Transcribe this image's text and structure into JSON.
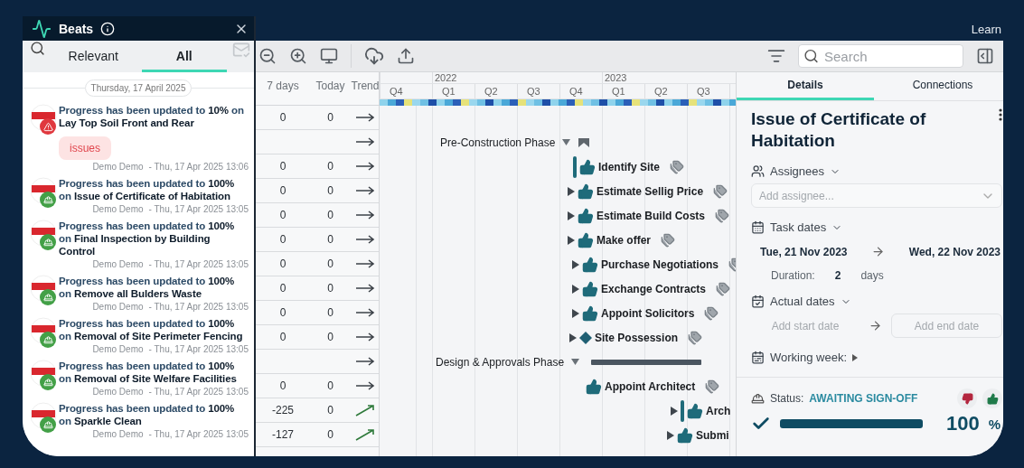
{
  "top_bar": {
    "link": "Learn"
  },
  "beats": {
    "title": "Beats",
    "tabs": [
      {
        "label": "Relevant",
        "selected": false
      },
      {
        "label": "All",
        "selected": true
      }
    ],
    "date": "Thursday, 17 April 2025",
    "items": [
      {
        "kind": "warning",
        "message": "Progress has been updated to **10%** on **Lay Top Soil Front and Rear**",
        "tag": "issues",
        "author": "Demo Demo",
        "time": "- Thu, 17 Apr 2025 13:06"
      },
      {
        "kind": "worker",
        "message": "Progress has been updated to **100%** on **Issue of Certificate of Habitation**",
        "author": "Demo Demo",
        "time": "- Thu, 17 Apr 2025 13:05"
      },
      {
        "kind": "worker",
        "message": "Progress has been updated to **100%** on **Final Inspection by Building Control**",
        "author": "Demo Demo",
        "time": "- Thu, 17 Apr 2025 13:05"
      },
      {
        "kind": "worker",
        "message": "Progress has been updated to **100%** on **Remove all Bulders Waste**",
        "author": "Demo Demo",
        "time": "- Thu, 17 Apr 2025 13:05"
      },
      {
        "kind": "worker",
        "message": "Progress has been updated to **100%** on **Removal of Site Perimeter Fencing**",
        "author": "Demo Demo",
        "time": "- Thu, 17 Apr 2025 13:05"
      },
      {
        "kind": "worker",
        "message": "Progress has been updated to **100%** on **Removal of Site Welfare Facilities**",
        "author": "Demo Demo",
        "time": "- Thu, 17 Apr 2025 13:05"
      },
      {
        "kind": "worker",
        "message": "Progress has been updated to **100%** on **Sparkle Clean**",
        "author": "Demo Demo",
        "time": "- Thu, 17 Apr 2025 13:05"
      }
    ]
  },
  "toolbar": {
    "search": {
      "placeholder": "Search"
    }
  },
  "table": {
    "columns": [
      "7 days",
      "Today",
      "Trend"
    ],
    "rows": [
      {
        "week": "0",
        "today": "0",
        "kind": "flat"
      },
      {
        "kind": "flat"
      },
      {
        "week": "0",
        "today": "0",
        "kind": "flat"
      },
      {
        "week": "0",
        "today": "0",
        "kind": "flat"
      },
      {
        "week": "0",
        "today": "0",
        "kind": "flat"
      },
      {
        "week": "0",
        "today": "0",
        "kind": "flat"
      },
      {
        "week": "0",
        "today": "0",
        "kind": "flat"
      },
      {
        "week": "0",
        "today": "0",
        "kind": "flat"
      },
      {
        "week": "0",
        "today": "0",
        "kind": "flat"
      },
      {
        "week": "0",
        "today": "0",
        "kind": "flat"
      },
      {
        "kind": "flat"
      },
      {
        "week": "0",
        "today": "0",
        "kind": "flat"
      },
      {
        "week": "-225",
        "today": "0",
        "kind": "up"
      },
      {
        "week": "-127",
        "today": "0",
        "kind": "up"
      }
    ]
  },
  "gantt": {
    "years": [
      "2022",
      "2023"
    ],
    "quarters": [
      "Q4",
      "Q1",
      "Q2",
      "Q3",
      "Q4",
      "Q1",
      "Q2",
      "Q3"
    ],
    "rows": [
      {
        "kind": "empty"
      },
      {
        "kind": "phase",
        "label": "Pre-Construction Phase"
      },
      {
        "kind": "task",
        "label": "Identify Site",
        "dependency": false,
        "bar": true
      },
      {
        "kind": "task",
        "label": "Estimate Sellig Price",
        "dependency": true,
        "bar": false
      },
      {
        "kind": "task",
        "label": "Estimate Build Costs",
        "dependency": true,
        "bar": false
      },
      {
        "kind": "task",
        "label": "Make offer",
        "dependency": true,
        "bar": false
      },
      {
        "kind": "task",
        "label": "Purchase Negotiations",
        "dependency": true,
        "bar": false
      },
      {
        "kind": "task",
        "label": "Exchange Contracts",
        "dependency": true,
        "bar": false
      },
      {
        "kind": "task",
        "label": "Appoint Solicitors",
        "dependency": true,
        "bar": false
      },
      {
        "kind": "milestone",
        "label": "Site Possession",
        "dependency": true
      },
      {
        "kind": "phase",
        "label": "Design & Approvals Phase"
      },
      {
        "kind": "task",
        "label": "Appoint Architect",
        "dependency": false,
        "bar": false
      },
      {
        "kind": "task",
        "label": "Arch",
        "dependency": true,
        "bar": true
      },
      {
        "kind": "task",
        "label": "Submi",
        "dependency": true,
        "bar": false
      }
    ]
  },
  "details": {
    "tabs": [
      {
        "label": "Details",
        "selected": true
      },
      {
        "label": "Connections",
        "selected": false
      }
    ],
    "title": "Issue of Certificate of Habitation",
    "assignees": {
      "label": "Assignees",
      "placeholder": "Add assignee..."
    },
    "task_dates": {
      "label": "Task dates",
      "start": "Tue, 21 Nov 2023",
      "end": "Wed, 22 Nov 2023",
      "duration_label": "Duration:",
      "duration": "2",
      "duration_unit": "days"
    },
    "actual_dates": {
      "label": "Actual dates",
      "start_placeholder": "Add start date",
      "end_placeholder": "Add end date"
    },
    "working_week": {
      "label": "Working week:"
    },
    "status": {
      "label": "Status:",
      "value": "AWAITING SIGN-OFF",
      "level": 1,
      "percent": "100",
      "percent_sign": "%"
    }
  }
}
